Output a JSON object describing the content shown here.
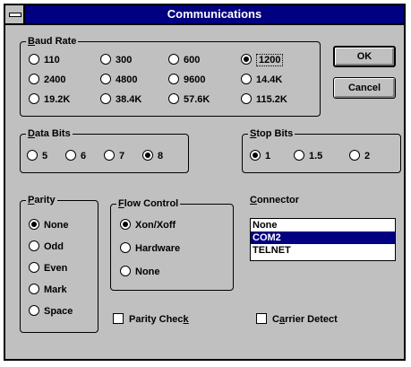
{
  "window": {
    "title": "Communications"
  },
  "baud_rate": {
    "label_first": "B",
    "label_rest": "aud Rate",
    "options": [
      "110",
      "300",
      "600",
      "1200",
      "2400",
      "4800",
      "9600",
      "14.4K",
      "19.2K",
      "38.4K",
      "57.6K",
      "115.2K"
    ],
    "selected": "1200"
  },
  "data_bits": {
    "label_first": "D",
    "label_rest": "ata Bits",
    "options": [
      "5",
      "6",
      "7",
      "8"
    ],
    "selected": "8"
  },
  "stop_bits": {
    "label_first": "S",
    "label_rest": "top Bits",
    "options": [
      "1",
      "1.5",
      "2"
    ],
    "selected": "1"
  },
  "parity": {
    "label_first": "P",
    "label_rest": "arity",
    "options": [
      "None",
      "Odd",
      "Even",
      "Mark",
      "Space"
    ],
    "selected": "None"
  },
  "flow_control": {
    "label_first": "F",
    "label_rest": "low Control",
    "options": [
      "Xon/Xoff",
      "Hardware",
      "None"
    ],
    "selected": "Xon/Xoff"
  },
  "connector": {
    "label_first": "C",
    "label_rest": "onnector",
    "items": [
      "None",
      "COM2",
      "TELNET"
    ],
    "selected": "COM2"
  },
  "checks": {
    "parity_check_pre": "Parity Chec",
    "parity_check_u": "k",
    "carrier_pre": "C",
    "carrier_u": "a",
    "carrier_post": "rrier Detect"
  },
  "buttons": {
    "ok": "OK",
    "cancel": "Cancel"
  }
}
